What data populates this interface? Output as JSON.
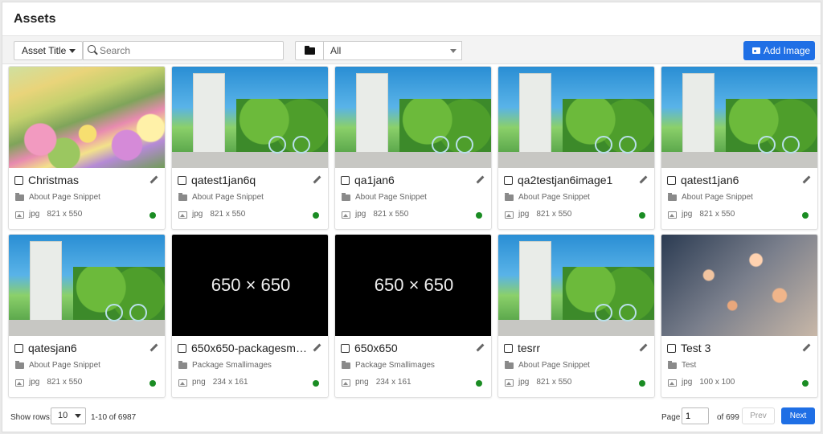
{
  "page": {
    "title": "Assets"
  },
  "toolbar": {
    "field_select": "Asset Title",
    "search_placeholder": "Search",
    "folder_select": "All",
    "add_label": "Add Image"
  },
  "assets": [
    {
      "name": "Christmas",
      "folder": "About Page Snippet",
      "type": "jpg",
      "dims": "821 x 550",
      "thumb": "flower"
    },
    {
      "name": "qatest1jan6q",
      "folder": "About Page Snippet",
      "type": "jpg",
      "dims": "821 x 550",
      "thumb": "bikes"
    },
    {
      "name": "qa1jan6",
      "folder": "About Page Snippet",
      "type": "jpg",
      "dims": "821 x 550",
      "thumb": "bikes"
    },
    {
      "name": "qa2testjan6image1",
      "folder": "About Page Snippet",
      "type": "jpg",
      "dims": "821 x 550",
      "thumb": "bikes"
    },
    {
      "name": "qatest1jan6",
      "folder": "About Page Snippet",
      "type": "jpg",
      "dims": "821 x 550",
      "thumb": "bikes"
    },
    {
      "name": "qatesjan6",
      "folder": "About Page Snippet",
      "type": "jpg",
      "dims": "821 x 550",
      "thumb": "bikes"
    },
    {
      "name": "650x650-packagesmall...",
      "folder": "Package Smallimages",
      "type": "png",
      "dims": "234 x 161",
      "thumb": "black",
      "thumb_text": "650 × 650"
    },
    {
      "name": "650x650",
      "folder": "Package Smallimages",
      "type": "png",
      "dims": "234 x 161",
      "thumb": "black",
      "thumb_text": "650 × 650"
    },
    {
      "name": "tesrr",
      "folder": "About Page Snippet",
      "type": "jpg",
      "dims": "821 x 550",
      "thumb": "bikes"
    },
    {
      "name": "Test 3",
      "folder": "Test",
      "type": "jpg",
      "dims": "100 x 100",
      "thumb": "network"
    }
  ],
  "status_color": "#1a8c23",
  "accent_color": "#1f6fe5",
  "footer": {
    "show_rows_label": "Show rows:",
    "rows_value": "10",
    "range": "1-10 of 6987",
    "page_label": "Page",
    "page_value": "1",
    "of_pages": "of 699",
    "prev_label": "Prev",
    "next_label": "Next"
  }
}
